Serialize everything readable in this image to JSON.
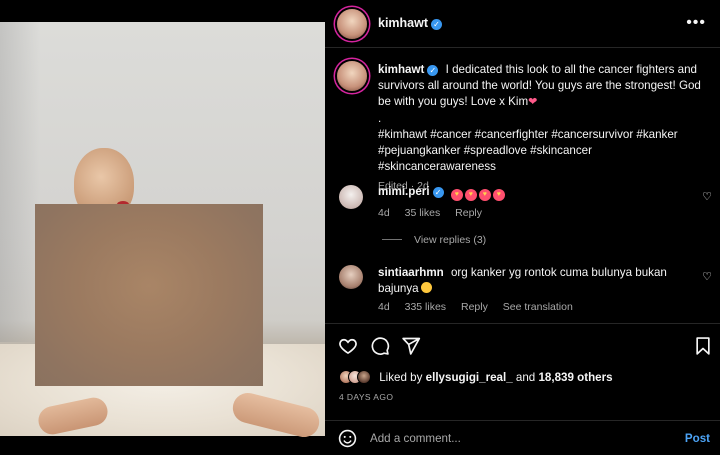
{
  "post": {
    "author": "kimhawt",
    "caption_text": "I dedicated this look to all the cancer fighters and survivors all around the world! You guys are the strongest! God be with you guys! Love x Kim",
    "caption_dot": ".",
    "hashtags": "#kimhawt #cancer #cancerfighter #cancersurvivor #kanker #pejuangkanker #spreadlove #skincancer #skincancerawareness",
    "caption_meta": "Edited · 2d"
  },
  "comments": [
    {
      "username": "mimi.peri",
      "age": "4d",
      "likes": "35 likes",
      "reply": "Reply"
    },
    {
      "username": "sintiaarhmn",
      "text": "org kanker yg rontok cuma bulunya bukan bajunya",
      "age": "4d",
      "likes": "335 likes",
      "reply": "Reply",
      "translate": "See translation"
    }
  ],
  "view_replies": "View replies (3)",
  "liked_by": {
    "prefix": "Liked by",
    "user": "ellysugigi_real_",
    "connector": "and",
    "others": "18,839 others"
  },
  "post_date": "4 DAYS AGO",
  "add_comment": {
    "placeholder": "Add a comment...",
    "post_label": "Post"
  },
  "colors": {
    "accent": "#4ca3f5",
    "verified": "#3897f0",
    "muted": "#a8a8a8"
  }
}
